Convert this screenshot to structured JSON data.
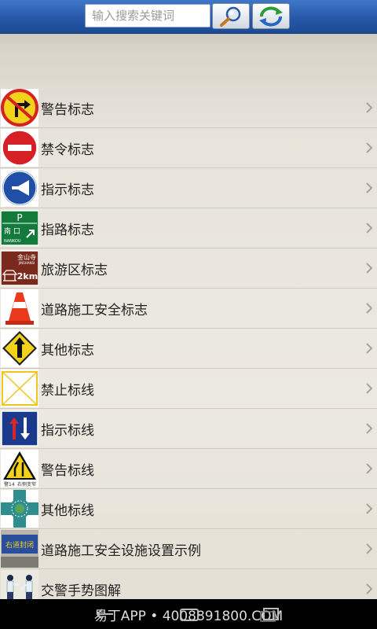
{
  "search": {
    "placeholder": "输入搜索关键词"
  },
  "toolbar": {
    "search_icon": "magnifier-icon",
    "refresh_icon": "refresh-icon"
  },
  "list": {
    "items": [
      {
        "label": "警告标志",
        "icon": "warning-sign-icon"
      },
      {
        "label": "禁令标志",
        "icon": "no-entry-sign-icon"
      },
      {
        "label": "指示标志",
        "icon": "horn-sign-icon"
      },
      {
        "label": "指路标志",
        "icon": "guide-sign-icon",
        "icon_text": [
          "P",
          "南 口",
          "NANKOU"
        ]
      },
      {
        "label": "旅游区标志",
        "icon": "tourist-sign-icon",
        "icon_text": [
          "金山寺",
          "JINSHANSI",
          "2km"
        ]
      },
      {
        "label": "道路施工安全标志",
        "icon": "traffic-cone-icon"
      },
      {
        "label": "其他标志",
        "icon": "diamond-arrow-sign-icon"
      },
      {
        "label": "禁止标线",
        "icon": "yellow-cross-marking-icon"
      },
      {
        "label": "指示标线",
        "icon": "two-way-arrows-sign-icon"
      },
      {
        "label": "警告标线",
        "icon": "lane-merge-warning-icon",
        "icon_text": [
          "警14",
          "右侧变窄"
        ]
      },
      {
        "label": "其他标线",
        "icon": "roundabout-marking-icon"
      },
      {
        "label": "道路施工安全设施设置示例",
        "icon": "roadwork-board-icon",
        "icon_text": [
          "右道封闭"
        ]
      },
      {
        "label": "交警手势图解",
        "icon": "police-gesture-icon"
      }
    ]
  },
  "footer": {
    "text": "易丁APP • 4008891800.COM"
  },
  "colors": {
    "topbar": "#2658a8",
    "list_bg": "#ebe7de",
    "divider": "#cfcabe",
    "footer": "#000000"
  }
}
